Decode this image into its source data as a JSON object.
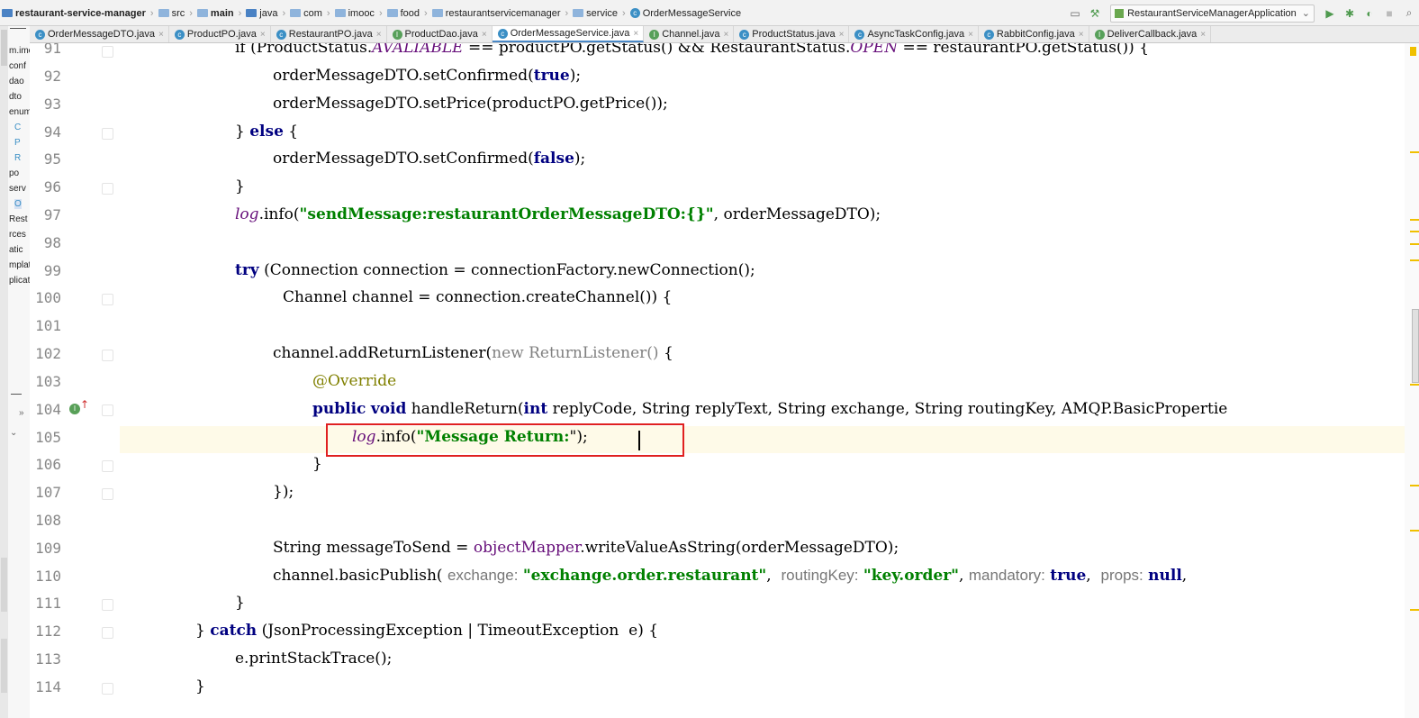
{
  "breadcrumb": {
    "items": [
      "restaurant-service-manager",
      "src",
      "main",
      "java",
      "com",
      "imooc",
      "food",
      "restaurantservicemanager",
      "service",
      "OrderMessageService"
    ]
  },
  "toolbar": {
    "run_config": "RestaurantServiceManagerApplication"
  },
  "tabs": [
    {
      "label": "OrderMessageDTO.java",
      "kind": "class"
    },
    {
      "label": "ProductPO.java",
      "kind": "class"
    },
    {
      "label": "RestaurantPO.java",
      "kind": "class"
    },
    {
      "label": "ProductDao.java",
      "kind": "interface"
    },
    {
      "label": "OrderMessageService.java",
      "kind": "class",
      "active": true
    },
    {
      "label": "Channel.java",
      "kind": "interface"
    },
    {
      "label": "ProductStatus.java",
      "kind": "class"
    },
    {
      "label": "AsyncTaskConfig.java",
      "kind": "class"
    },
    {
      "label": "RabbitConfig.java",
      "kind": "class"
    },
    {
      "label": "DeliverCallback.java",
      "kind": "interface"
    }
  ],
  "sidebar": {
    "tree": [
      "m.imo",
      "conf",
      "dao",
      "dto",
      "enum",
      "C",
      "P",
      "R",
      "po",
      "serv",
      "O",
      "Rest",
      "rces",
      "atic",
      "mplat",
      "plicat"
    ]
  },
  "editor": {
    "active_line": 105,
    "lines": [
      {
        "n": "91"
      },
      {
        "n": "92"
      },
      {
        "n": "93"
      },
      {
        "n": "94"
      },
      {
        "n": "95"
      },
      {
        "n": "96"
      },
      {
        "n": "97"
      },
      {
        "n": "98"
      },
      {
        "n": "99"
      },
      {
        "n": "100"
      },
      {
        "n": "101"
      },
      {
        "n": "102"
      },
      {
        "n": "103"
      },
      {
        "n": "104"
      },
      {
        "n": "105"
      },
      {
        "n": "106"
      },
      {
        "n": "107"
      },
      {
        "n": "108"
      },
      {
        "n": "109"
      },
      {
        "n": "110"
      },
      {
        "n": "111"
      },
      {
        "n": "112"
      },
      {
        "n": "113"
      },
      {
        "n": "114"
      }
    ],
    "code": {
      "l91": [
        "if (ProductStatus.",
        "AVALIABLE",
        " == productPO.getStatus() && RestaurantStatus.",
        "OPEN",
        " == restaurantPO.getStatus()) {"
      ],
      "l92": [
        "orderMessageDTO.setConfirmed(",
        "true",
        ");"
      ],
      "l93": [
        "orderMessageDTO.setPrice(productPO.getPrice());"
      ],
      "l94": [
        "} ",
        "else",
        " {"
      ],
      "l95": [
        "orderMessageDTO.setConfirmed(",
        "false",
        ");"
      ],
      "l96": [
        "}"
      ],
      "l97": [
        "log",
        ".info(",
        "\"sendMessage:restaurantOrderMessageDTO:{}\"",
        ", orderMessageDTO);"
      ],
      "l99": [
        "try",
        " (Connection connection = connectionFactory.newConnection();"
      ],
      "l100": [
        "Channel channel = connection.createChannel()) {"
      ],
      "l102": [
        "channel.addReturnListener(",
        "new ReturnListener()",
        " {"
      ],
      "l103": [
        "@Override"
      ],
      "l104": [
        "public",
        " ",
        "void",
        " handleReturn(",
        "int",
        " replyCode, String replyText, String exchange, String routingKey, AMQP.BasicPropertie"
      ],
      "l105": [
        "log",
        ".info(",
        "\"Message Return:",
        "\");"
      ],
      "l106": [
        "}"
      ],
      "l107": [
        "});"
      ],
      "l109": [
        "String messageToSend = ",
        "objectMapper",
        ".writeValueAsString(orderMessageDTO);"
      ],
      "l110": [
        "channel.basicPublish(",
        "exchange:",
        "\"exchange.order.restaurant\"",
        ",",
        "routingKey:",
        "\"key.order\"",
        ",",
        "mandatory:",
        "true",
        ",",
        "props:",
        "null",
        ","
      ],
      "l111": [
        "}"
      ],
      "l112": [
        "} ",
        "catch",
        " (JsonProcessingException | TimeoutException  e) {"
      ],
      "l113": [
        "e.printStackTrace();"
      ],
      "l114": [
        "}"
      ]
    }
  },
  "colors": {
    "keyword": "#000080",
    "string": "#008000",
    "field": "#660e7a",
    "annotation": "#808000",
    "highlight_box": "#e02020"
  }
}
